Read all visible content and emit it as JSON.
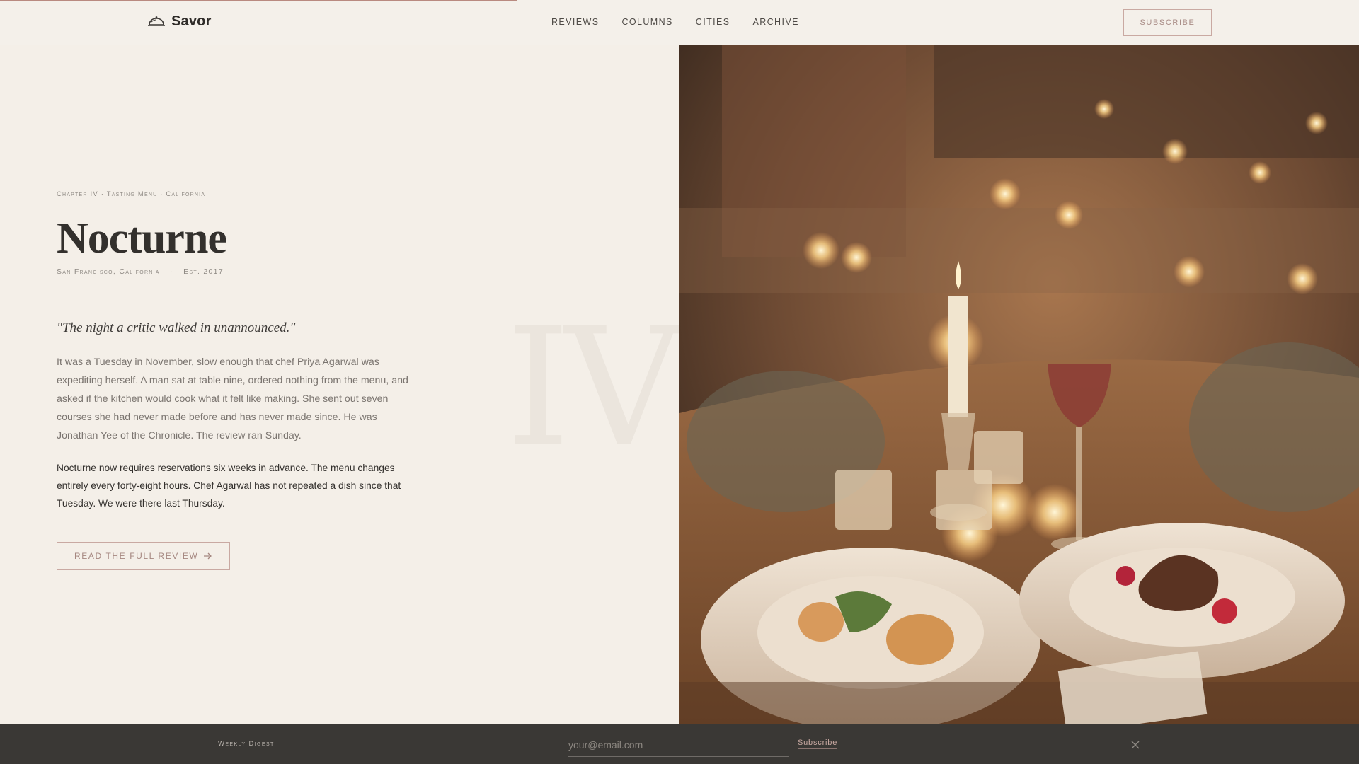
{
  "header": {
    "brand": "Savor",
    "nav": [
      "REVIEWS",
      "COLUMNS",
      "CITIES",
      "ARCHIVE"
    ],
    "subscribe_label": "SUBSCRIBE",
    "reading_progress": 0.38
  },
  "article": {
    "kicker": "Chapter IV · Tasting Menu · California",
    "title": "Nocturne",
    "location": "San Francisco, California",
    "meta_separator": "·",
    "established": "Est. 2017",
    "quote": "\"The night a critic walked in unannounced.\"",
    "paragraph1": "It was a Tuesday in November, slow enough that chef Priya Agarwal was expediting herself. A man sat at table nine, ordered nothing from the menu, and asked if the kitchen would cook what it felt like making. She sent out seven courses she had never made before and has never made since. He was Jonathan Yee of the Chronicle. The review ran Sunday.",
    "paragraph2": "Nocturne now requires reservations six weeks in advance. The menu changes entirely every forty-eight hours. Chef Agarwal has not repeated a dish since that Tuesday. We were there last Thursday.",
    "cta_label": "READ THE FULL REVIEW",
    "numeral": "IV"
  },
  "digest": {
    "label": "Weekly Digest",
    "email_placeholder": "your@email.com",
    "subscribe_label": "Subscribe"
  },
  "colors": {
    "accent": "#c9a9a2",
    "background": "#f4efe8",
    "footer": "#3a3835"
  }
}
